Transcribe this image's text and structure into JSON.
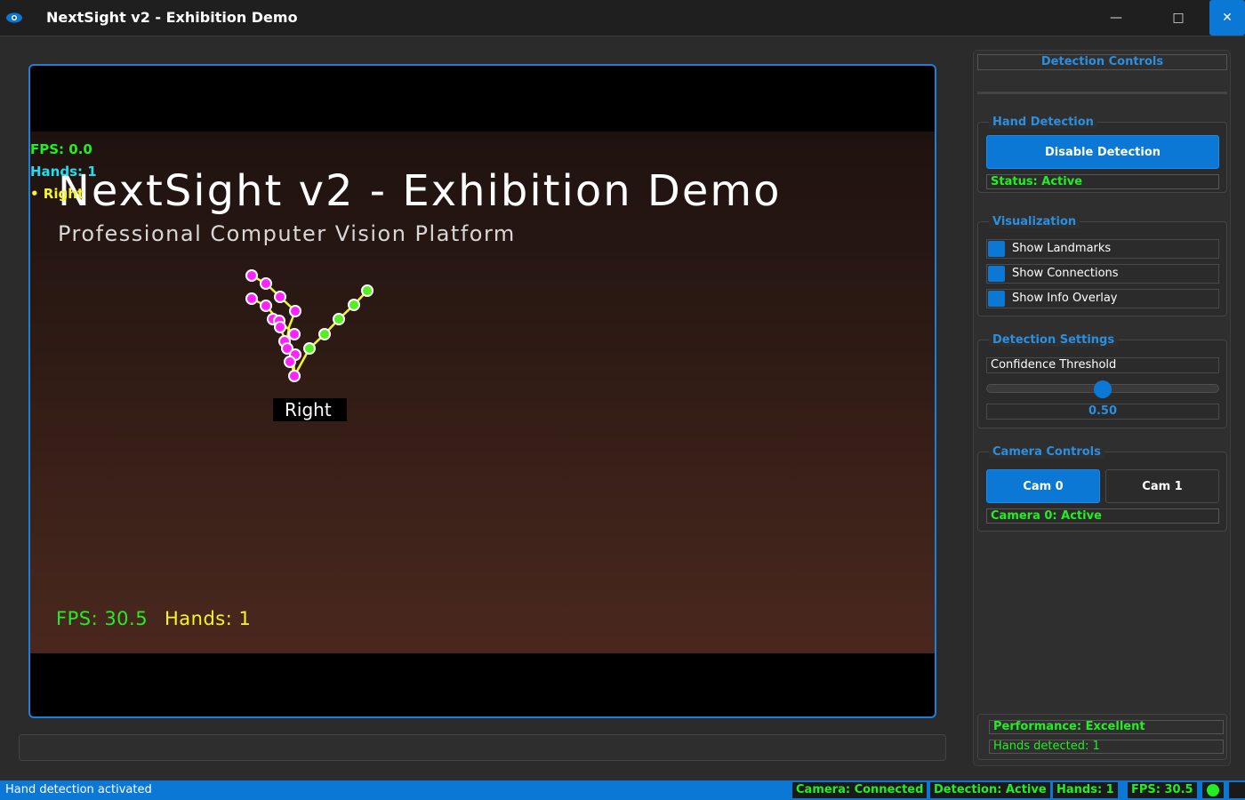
{
  "window": {
    "title": "NextSight v2 - Exhibition Demo",
    "minimize_glyph": "—",
    "maximize_glyph": "□",
    "close_glyph": "✕"
  },
  "video": {
    "overlay_fps": "FPS: 0.0",
    "overlay_hands": "Hands: 1",
    "overlay_hand_label": "• Right",
    "heading": "NextSight v2 - Exhibition Demo",
    "subheading": "Professional Computer Vision Platform",
    "hand_tag": "Right",
    "footer_fps": "FPS: 30.5",
    "footer_hands": "Hands: 1"
  },
  "panel": {
    "title": "Detection Controls",
    "hand_detection": {
      "title": "Hand Detection",
      "toggle_label": "Disable Detection",
      "status": "Status: Active"
    },
    "visualization": {
      "title": "Visualization",
      "options": [
        {
          "label": "Show Landmarks",
          "checked": true
        },
        {
          "label": "Show Connections",
          "checked": true
        },
        {
          "label": "Show Info Overlay",
          "checked": true
        }
      ]
    },
    "detection_settings": {
      "title": "Detection Settings",
      "threshold_label": "Confidence Threshold",
      "threshold_value": "0.50",
      "threshold_level": 0.5
    },
    "camera_controls": {
      "title": "Camera Controls",
      "cam0_label": "Cam 0",
      "cam1_label": "Cam 1",
      "status": "Camera 0: Active"
    },
    "performance": "Performance: Excellent",
    "hands_detected": "Hands detected: 1"
  },
  "statusbar": {
    "message": "Hand detection activated",
    "camera": "Camera: Connected",
    "detection": "Detection: Active",
    "hands": "Hands: 1",
    "fps": "FPS: 30.5"
  },
  "colors": {
    "accent": "#0a78d4",
    "status_green": "#22ee22",
    "landmark_magenta": "#ff22ff",
    "landmark_green": "#55ee22",
    "connection_yellow": "#f5f52a"
  }
}
